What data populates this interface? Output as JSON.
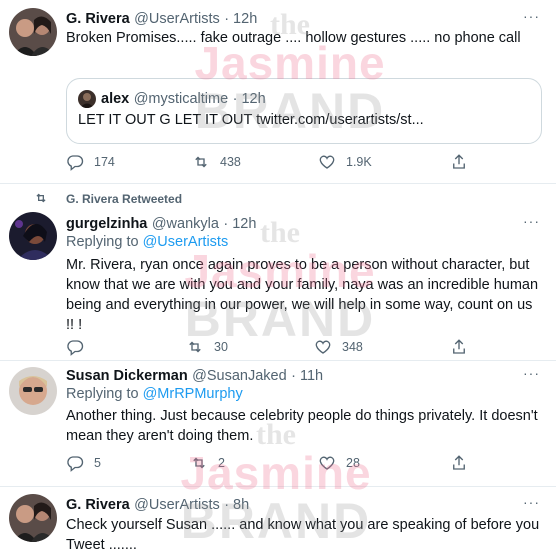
{
  "tweets": [
    {
      "name": "G. Rivera",
      "handle": "@UserArtists",
      "time": "· 12h",
      "text": "Broken Promises..... fake outrage .... hollow gestures ..... no phone call",
      "quote": {
        "name": "alex",
        "handle": "@mysticaltime",
        "time": "· 12h",
        "text": "LET IT OUT G LET IT OUT twitter.com/userartists/st..."
      },
      "replies": "174",
      "retweets": "438",
      "likes": "1.9K"
    },
    {
      "retweeted_by": "G. Rivera Retweeted",
      "name": "gurgelzinha",
      "handle": "@wankyla",
      "time": "· 12h",
      "replying_label": "Replying to",
      "replying_to": "@UserArtists",
      "text": "Mr. Rivera, ryan once again proves to be a person without character, but know that we are with you and your family, naya was an incredible human being and everything in our power, we will help in some way, count on us !! !",
      "replies": "",
      "retweets": "30",
      "likes": "348"
    },
    {
      "name": "Susan Dickerman",
      "handle": "@SusanJaked",
      "time": "· 11h",
      "replying_label": "Replying to",
      "replying_to": "@MrRPMurphy",
      "text": "Another thing. Just because celebrity people do things privately. It doesn't mean they aren't doing them.",
      "replies": "5",
      "retweets": "2",
      "likes": "28"
    },
    {
      "name": "G. Rivera",
      "handle": "@UserArtists",
      "time": "· 8h",
      "text": "Check yourself Susan ...... and know what you are speaking of before you Tweet ......."
    }
  ],
  "more_glyph": "···",
  "watermark": {
    "the": "the",
    "jasmine": "Jasmine",
    "brand": "BRAND"
  },
  "colors": {
    "link": "#1d9bf0",
    "muted": "#536471",
    "text": "#0f1419"
  },
  "icons": [
    "reply-icon",
    "retweet-icon",
    "like-icon",
    "share-icon",
    "more-icon"
  ]
}
